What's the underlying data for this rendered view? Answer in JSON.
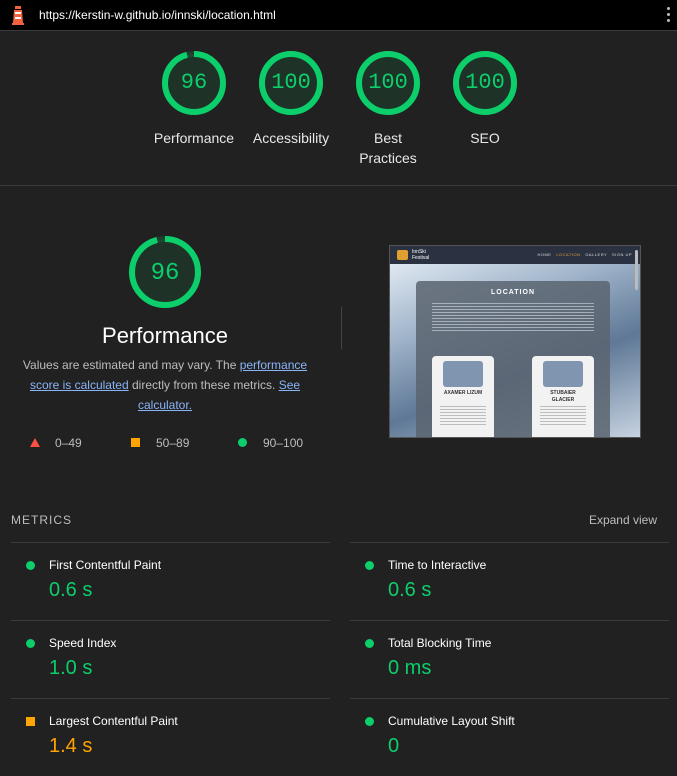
{
  "browser": {
    "url": "https://kerstin-w.github.io/innski/location.html",
    "logo_icon": "lighthouse-icon",
    "menu_icon": "kebab-menu-icon"
  },
  "colors": {
    "pass": "#0cce6b",
    "average": "#ffa400",
    "fail": "#ff4e42",
    "background": "#212121"
  },
  "gauges": [
    {
      "label": "Performance",
      "score": "96",
      "value": 96
    },
    {
      "label": "Accessibility",
      "score": "100",
      "value": 100
    },
    {
      "label": "Best Practices",
      "score": "100",
      "value": 100
    },
    {
      "label": "SEO",
      "score": "100",
      "value": 100
    }
  ],
  "performance": {
    "score": "96",
    "value": 96,
    "title": "Performance",
    "desc_prefix": "Values are estimated and may vary. The ",
    "desc_link1": "performance score is calculated",
    "desc_middle": " directly from these metrics. ",
    "desc_link2": "See calculator."
  },
  "legend": [
    {
      "shape": "triangle",
      "range": "0–49"
    },
    {
      "shape": "square",
      "range": "50–89"
    },
    {
      "shape": "circle",
      "range": "90–100"
    }
  ],
  "thumbnail": {
    "brand_line1": "InnSki",
    "brand_line2": "Festival",
    "nav_links": [
      "HOME",
      "LOCATION",
      "GALLERY",
      "SIGN UP"
    ],
    "heading": "LOCATION",
    "cards": [
      "AXAMER LIZUM",
      "STUBAIER GLACIER"
    ]
  },
  "metrics": {
    "title": "METRICS",
    "expand": "Expand view",
    "items": [
      {
        "name": "First Contentful Paint",
        "value": "0.6 s",
        "status": "pass"
      },
      {
        "name": "Time to Interactive",
        "value": "0.6 s",
        "status": "pass"
      },
      {
        "name": "Speed Index",
        "value": "1.0 s",
        "status": "pass"
      },
      {
        "name": "Total Blocking Time",
        "value": "0 ms",
        "status": "pass"
      },
      {
        "name": "Largest Contentful Paint",
        "value": "1.4 s",
        "status": "average"
      },
      {
        "name": "Cumulative Layout Shift",
        "value": "0",
        "status": "pass"
      }
    ]
  }
}
